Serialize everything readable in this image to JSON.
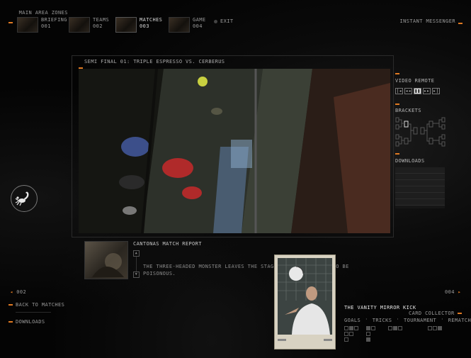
{
  "nav": {
    "zones_label": "MAIN AREA ZONES",
    "items": [
      {
        "title": "BRIEFING",
        "num": "001"
      },
      {
        "title": "TEAMS",
        "num": "002"
      },
      {
        "title": "MATCHES",
        "num": "003"
      },
      {
        "title": "GAME",
        "num": "004"
      }
    ],
    "exit_label": "EXIT",
    "messenger_label": "INSTANT MESSENGER"
  },
  "video": {
    "title": "SEMI FINAL 01: TRIPLE ESPRESSO VS. CERBERUS"
  },
  "remote": {
    "title": "VIDEO REMOTE",
    "buttons": [
      "|◂",
      "◂◂",
      "❚❚",
      "▸▸",
      "▸|"
    ]
  },
  "brackets": {
    "title": "BRACKETS"
  },
  "downloads_panel": {
    "title": "DOWNLOADS"
  },
  "report": {
    "title": "CANTONAS MATCH REPORT",
    "text": "THE THREE-HEADED MONSTER LEAVES THE STAGE... BLEND PROVED TO BE POISONOUS.",
    "scroll_up": "▲",
    "scroll_down": "▼"
  },
  "pager": {
    "prev": "002",
    "next": "004",
    "prev_arrow": "◂",
    "next_arrow": "▸"
  },
  "left_links": {
    "back": "BACK TO MATCHES",
    "downloads": "DOWNLOADS"
  },
  "card": {
    "title": "THE VANITY MIRROR KICK",
    "collector": "CARD COLLECTOR",
    "tabs": [
      "GOALS",
      "TRICKS",
      "TOURNAMENT",
      "REMATCH"
    ]
  },
  "colors": {
    "accent": "#e07a22",
    "text": "#9a9a9a",
    "bg": "#030303"
  }
}
